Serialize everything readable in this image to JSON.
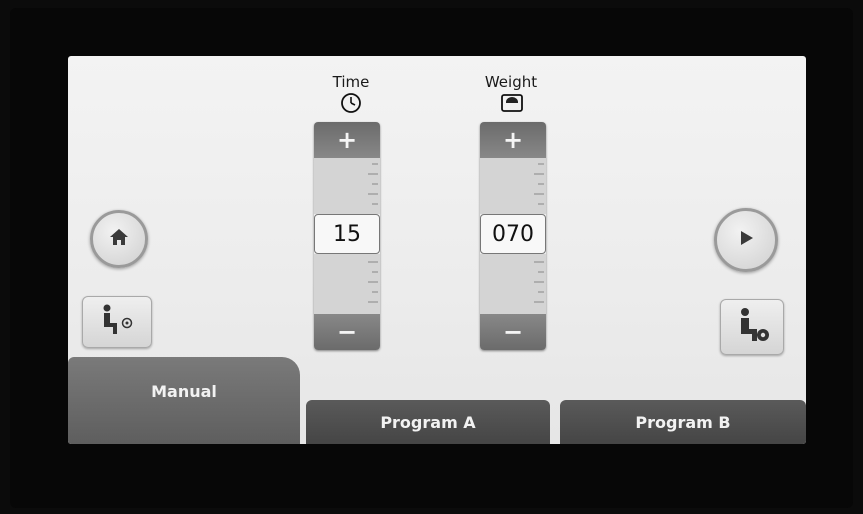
{
  "time": {
    "label": "Time",
    "icon": "clock-icon",
    "value": "15",
    "plus": "+",
    "minus": "−"
  },
  "weight": {
    "label": "Weight",
    "icon": "scale-icon",
    "value": "070",
    "plus": "+",
    "minus": "−"
  },
  "side_buttons": {
    "home": "home-icon",
    "user_left": "seated-user-icon",
    "play": "play-icon",
    "user_right": "seated-user-settings-icon"
  },
  "tabs": [
    {
      "label": "Manual",
      "active": true
    },
    {
      "label": "Program A",
      "active": false
    },
    {
      "label": "Program B",
      "active": false
    }
  ],
  "colors": {
    "tab_active": "#666666",
    "tab_inactive": "#4d4d4d",
    "screen_bg": "#efefef"
  }
}
